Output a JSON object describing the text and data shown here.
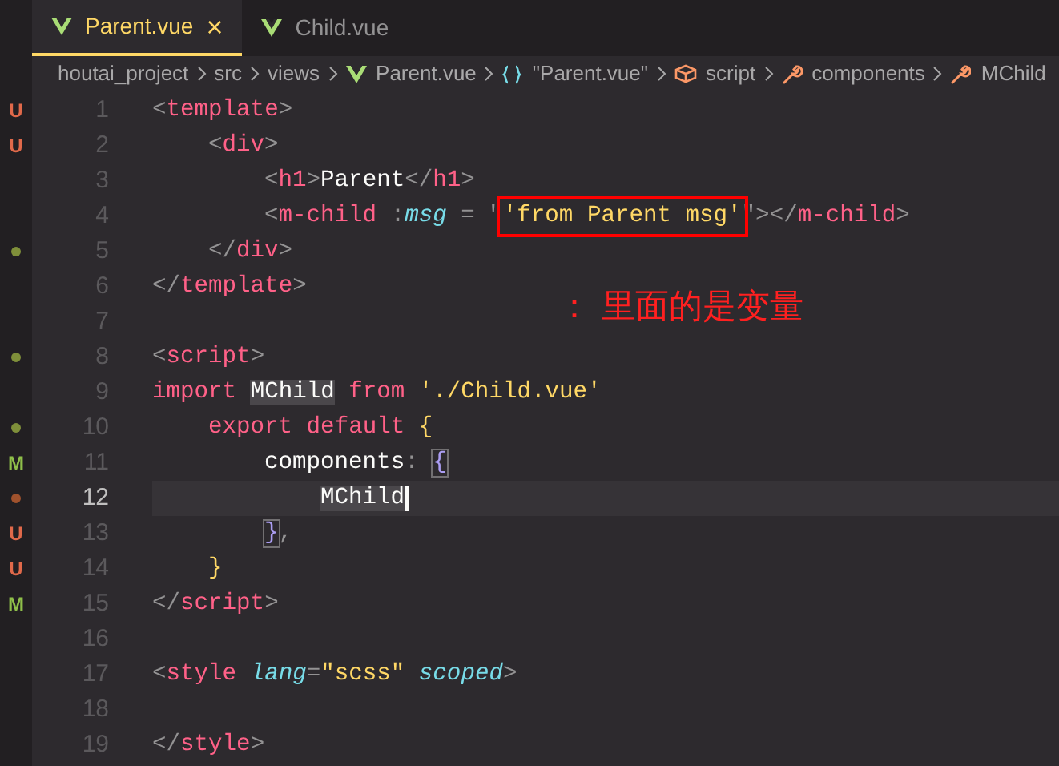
{
  "tabs": [
    {
      "label": "Parent.vue",
      "selected": true,
      "close": "×"
    },
    {
      "label": "Child.vue",
      "selected": false
    }
  ],
  "breadcrumb": [
    {
      "text": "houtai_project",
      "kind": "folder"
    },
    {
      "text": "src",
      "kind": "folder"
    },
    {
      "text": "views",
      "kind": "folder"
    },
    {
      "text": "Parent.vue",
      "kind": "vue"
    },
    {
      "text": "\"Parent.vue\"",
      "kind": "object"
    },
    {
      "text": "script",
      "kind": "module"
    },
    {
      "text": "components",
      "kind": "property"
    },
    {
      "text": "MChild",
      "kind": "property"
    }
  ],
  "lines": [
    {
      "number": "1",
      "marker": {
        "kind": "letter",
        "text": "U",
        "color": "#e0694a"
      },
      "tokens": [
        {
          "t": "<",
          "kind": "p"
        },
        {
          "t": "template",
          "kind": "tag"
        },
        {
          "t": ">",
          "kind": "p"
        }
      ],
      "children": [
        {
          "number": "2",
          "marker": {
            "kind": "letter",
            "text": "U",
            "color": "#e0694a"
          },
          "tokens": [
            {
              "t": "<",
              "kind": "p"
            },
            {
              "t": "div",
              "kind": "tag"
            },
            {
              "t": ">",
              "kind": "p"
            }
          ],
          "children": [
            {
              "number": "3",
              "tokens": [
                {
                  "t": "<",
                  "kind": "p"
                },
                {
                  "t": "h1",
                  "kind": "tag"
                },
                {
                  "t": ">",
                  "kind": "p"
                },
                {
                  "t": "Parent",
                  "kind": "text"
                },
                {
                  "t": "</",
                  "kind": "p"
                },
                {
                  "t": "h1",
                  "kind": "tag"
                },
                {
                  "t": ">",
                  "kind": "p"
                }
              ]
            },
            {
              "number": "4",
              "tokens": [
                {
                  "t": "<",
                  "kind": "p"
                },
                {
                  "t": "m-child",
                  "kind": "tag"
                },
                {
                  "t": " :",
                  "kind": "p"
                },
                {
                  "t": "msg",
                  "kind": "attr"
                },
                {
                  "t": " = \"",
                  "kind": "p"
                },
                {
                  "t": "'from Parent msg'",
                  "kind": "str",
                  "boxed": true
                },
                {
                  "t": "\">",
                  "kind": "p"
                },
                {
                  "t": "</",
                  "kind": "p"
                },
                {
                  "t": "m-child",
                  "kind": "tag"
                },
                {
                  "t": ">",
                  "kind": "p"
                }
              ]
            }
          ]
        },
        {
          "number": "5",
          "marker": {
            "kind": "dot",
            "color": "#7f8f3a"
          },
          "tokens": [
            {
              "t": "</",
              "kind": "p"
            },
            {
              "t": "div",
              "kind": "tag"
            },
            {
              "t": ">",
              "kind": "p"
            }
          ]
        }
      ]
    },
    {
      "number": "6",
      "tokens": [
        {
          "t": "</",
          "kind": "p"
        },
        {
          "t": "template",
          "kind": "tag"
        },
        {
          "t": ">",
          "kind": "p"
        }
      ]
    },
    {
      "number": "7"
    },
    {
      "number": "8",
      "marker": {
        "kind": "dot",
        "color": "#7f8f3a"
      },
      "tokens": [
        {
          "t": "<",
          "kind": "p"
        },
        {
          "t": "script",
          "kind": "tag"
        },
        {
          "t": ">",
          "kind": "p"
        }
      ]
    },
    {
      "number": "9",
      "tokens": [
        {
          "t": "import ",
          "kind": "kw"
        },
        {
          "t": "MChild",
          "kind": "text",
          "highlight": true
        },
        {
          "t": " from ",
          "kind": "kw"
        },
        {
          "t": "'./Child.vue'",
          "kind": "str"
        }
      ],
      "children": [
        {
          "number": "10",
          "marker": {
            "kind": "dot",
            "color": "#7f8f3a"
          },
          "tokens": [
            {
              "t": "export default ",
              "kind": "kw"
            },
            {
              "t": "{",
              "kind": "brace"
            }
          ],
          "children": [
            {
              "number": "11",
              "marker": {
                "kind": "letter",
                "text": "M",
                "color": "#8fbf4a"
              },
              "tokens": [
                {
                  "t": "components",
                  "kind": "text"
                },
                {
                  "t": ": ",
                  "kind": "p"
                },
                {
                  "t": "{",
                  "kind": "brace2",
                  "matched": true
                }
              ],
              "children": [
                {
                  "number": "12",
                  "current": true,
                  "marker": {
                    "kind": "dot",
                    "color": "#a0522d"
                  },
                  "tokens": [
                    {
                      "t": "MChild",
                      "kind": "text",
                      "highlight": true,
                      "cursor": true
                    }
                  ]
                }
              ]
            },
            {
              "number": "13",
              "marker": {
                "kind": "letter",
                "text": "U",
                "color": "#e0694a"
              },
              "tokens": [
                {
                  "t": "}",
                  "kind": "brace2",
                  "matched": true
                },
                {
                  "t": ",",
                  "kind": "p"
                }
              ]
            }
          ]
        },
        {
          "number": "14",
          "marker": {
            "kind": "letter",
            "text": "U",
            "color": "#e0694a"
          },
          "tokens": [
            {
              "t": "}",
              "kind": "brace"
            }
          ]
        }
      ]
    },
    {
      "number": "15",
      "marker": {
        "kind": "letter",
        "text": "M",
        "color": "#8fbf4a"
      },
      "tokens": [
        {
          "t": "</",
          "kind": "p"
        },
        {
          "t": "script",
          "kind": "tag"
        },
        {
          "t": ">",
          "kind": "p"
        }
      ]
    },
    {
      "number": "16"
    },
    {
      "number": "17",
      "tokens": [
        {
          "t": "<",
          "kind": "p"
        },
        {
          "t": "style ",
          "kind": "tag"
        },
        {
          "t": "lang",
          "kind": "attr"
        },
        {
          "t": "=",
          "kind": "p"
        },
        {
          "t": "\"scss\" ",
          "kind": "str"
        },
        {
          "t": "scoped",
          "kind": "attr"
        },
        {
          "t": ">",
          "kind": "p"
        }
      ]
    },
    {
      "number": "18"
    },
    {
      "number": "19",
      "tokens": [
        {
          "t": "</",
          "kind": "p"
        },
        {
          "t": "style",
          "kind": "tag"
        },
        {
          "t": ">",
          "kind": "p"
        }
      ]
    }
  ],
  "annotation": "： 里面的是变量"
}
